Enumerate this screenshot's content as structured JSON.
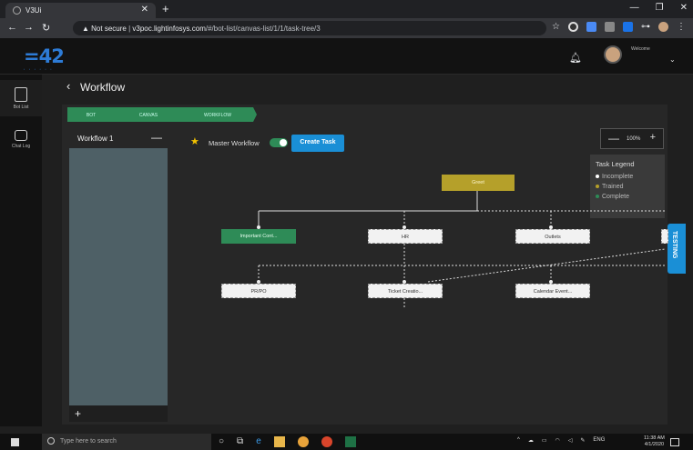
{
  "browser": {
    "tab_title": "V3Ui",
    "url_security": "Not secure",
    "url_host": "v3poc.lightinfosys.com",
    "url_path": "/#/bot-list/canvas-list/1/1/task-tree/3"
  },
  "header": {
    "logo": "=42",
    "welcome": "Welcome"
  },
  "sidebar": {
    "items": [
      {
        "label": "Bot List",
        "icon": "clipboard-icon"
      },
      {
        "label": "Chat Log",
        "icon": "chat-icon"
      }
    ]
  },
  "page": {
    "title": "Workflow"
  },
  "breadcrumb": [
    "BOT",
    "CANVAS",
    "WORKFLOW"
  ],
  "workflow_panel": {
    "item": "Workflow 1",
    "collapse": "—",
    "add": "+"
  },
  "toolbar": {
    "master_label": "Master Workflow",
    "create_task": "Create Task",
    "zoom_minus": "—",
    "zoom_value": "100%",
    "zoom_plus": "+"
  },
  "legend": {
    "title": "Task Legend",
    "items": [
      {
        "label": "Incomplete",
        "color": "#ffffff"
      },
      {
        "label": "Trained",
        "color": "#b5a02a"
      },
      {
        "label": "Complete",
        "color": "#2e8b57"
      }
    ]
  },
  "testing": "TESTING",
  "tree": {
    "root": "Greet",
    "level1": [
      "Important Cont...",
      "HR",
      "Outlets"
    ],
    "level2": [
      "PR/PO",
      "Ticket Creatio...",
      "Calendar Event..."
    ]
  },
  "taskbar": {
    "search_placeholder": "Type here to search",
    "lang": "ENG",
    "time": "11:38 AM",
    "date": "4/1/2020"
  },
  "colors": {
    "accent": "#1a8fd6",
    "complete": "#2e8b57",
    "trained": "#b5a02a"
  }
}
